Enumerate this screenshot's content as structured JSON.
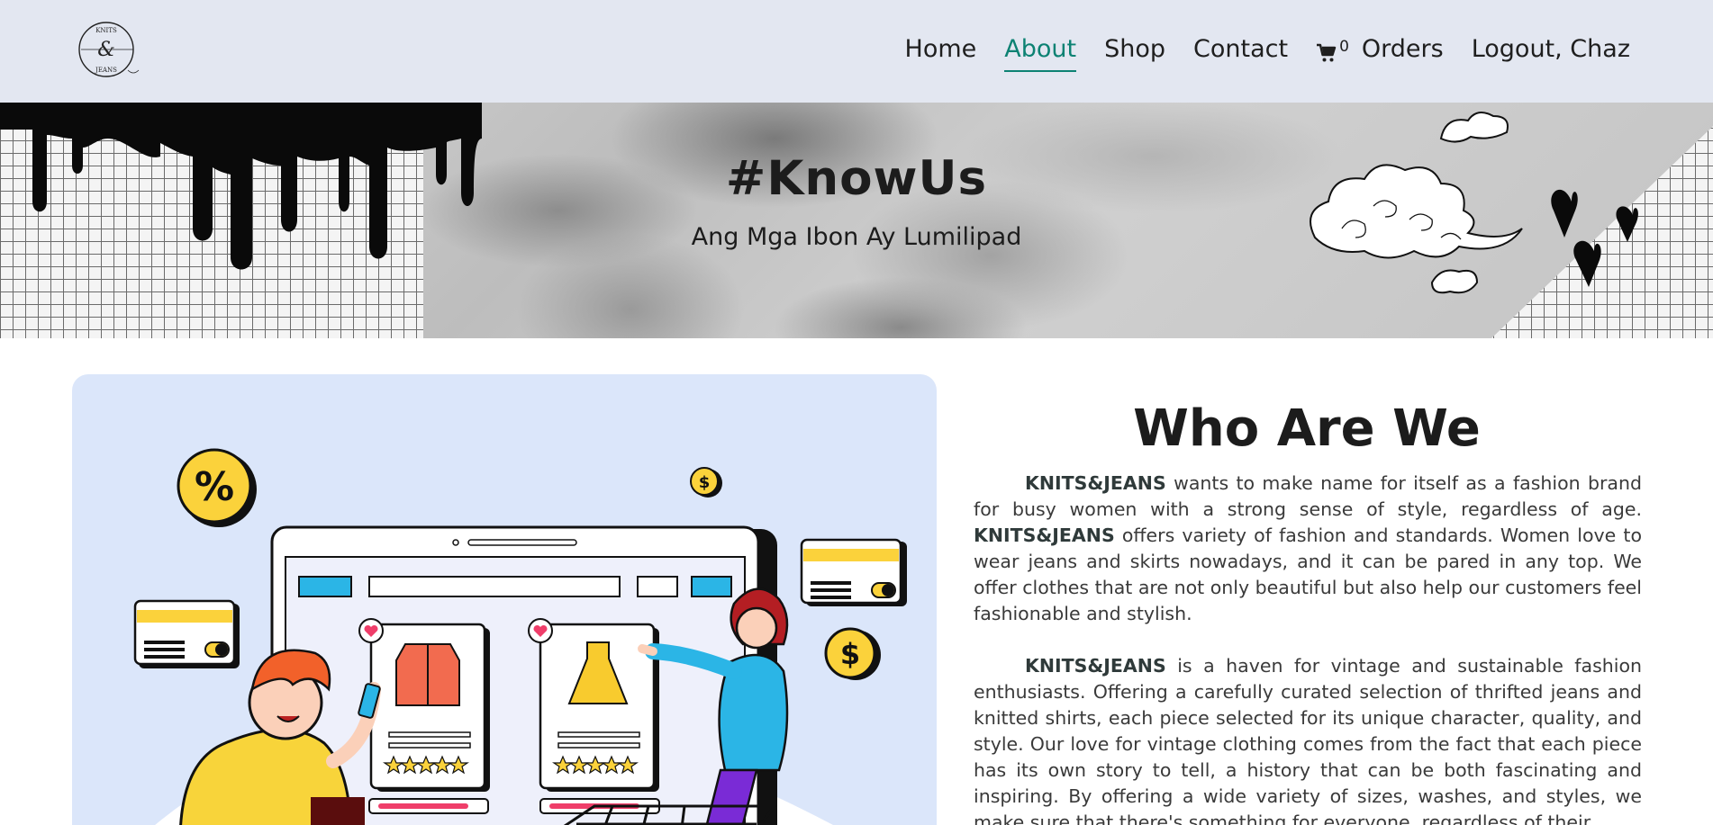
{
  "brand": {
    "logo_top": "KNITS",
    "logo_mid": "&",
    "logo_bottom": "JEANS"
  },
  "nav": {
    "home": "Home",
    "about": "About",
    "shop": "Shop",
    "contact": "Contact",
    "cart_count": "0",
    "orders": "Orders",
    "logout": "Logout, Chaz",
    "active": "About"
  },
  "banner": {
    "title": "#KnowUs",
    "subtitle": "Ang Mga Ibon Ay Lumilipad"
  },
  "about": {
    "heading": "Who Are We",
    "p1_brand": "KNITS&JEANS",
    "p1_text1": " wants to make name for itself as a fashion brand for busy women with a strong sense of style, regardless of age. ",
    "p1_brand2": "KNITS&JEANS",
    "p1_text2": " offers variety of fashion and standards. Women love to wear jeans and skirts nowadays, and it can be pared in any top. We offer clothes that are not only beautiful but also help our customers feel fashionable and stylish.",
    "p2_brand": "KNITS&JEANS",
    "p2_text": " is a haven for vintage and sustainable fashion enthusiasts. Offering a carefully curated selection of thrifted jeans and knitted shirts, each piece selected for its unique character, quality, and style. Our love for vintage clothing comes from the fact that each piece has its own story to tell, a history that can be both fascinating and inspiring. By offering a wide variety of sizes, washes, and styles, we make sure that there's something for everyone, regardless of their"
  },
  "illustration": {
    "percent_symbol": "%",
    "dollar_symbol": "$",
    "rating": 5
  },
  "colors": {
    "nav_bg": "#e3e7f1",
    "active": "#0d8273",
    "illus_bg": "#dbe6fa"
  },
  "icons": [
    "cart-icon",
    "heart-icon",
    "star-icon",
    "credit-card-icon",
    "dollar-coin-icon",
    "percent-badge-icon"
  ]
}
